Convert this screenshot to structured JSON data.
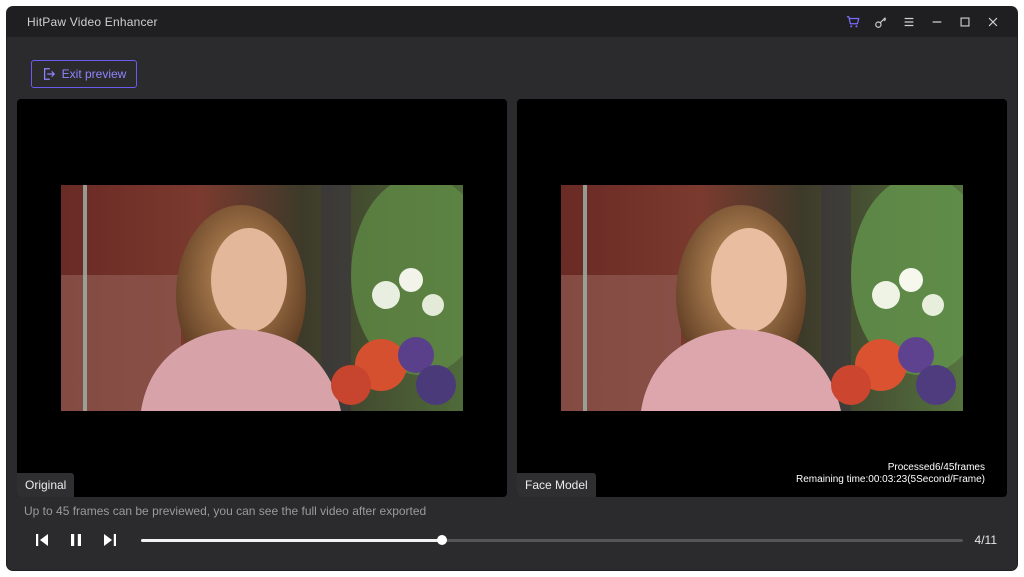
{
  "window": {
    "title": "HitPaw Video Enhancer"
  },
  "titlebar_icons": [
    "cart-icon",
    "key-icon",
    "menu-icon",
    "minimize-icon",
    "maximize-icon",
    "close-icon"
  ],
  "colors": {
    "accent": "#6b5cf0",
    "background": "#2b2b2d",
    "titlebar": "#1f1f21"
  },
  "toolbar": {
    "exit_preview_label": "Exit preview"
  },
  "panes": {
    "original_label": "Original",
    "model_label": "Face Model",
    "processed_text": "Processed6/45frames",
    "remaining_text": "Remaining time:00:03:23(5Second/Frame)"
  },
  "footer": {
    "hint": "Up to 45 frames can be previewed, you can see the full video after exported",
    "counter": "4/11",
    "progress": 0.366
  }
}
